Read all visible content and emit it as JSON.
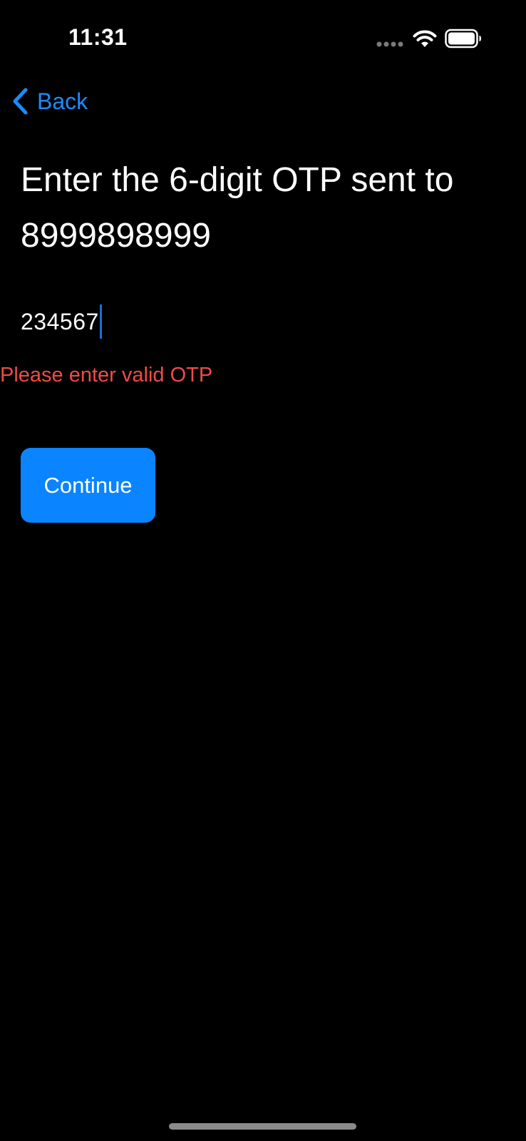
{
  "status_bar": {
    "time": "11:31",
    "icons": [
      "cellular-signal-icon",
      "wifi-icon",
      "battery-icon"
    ]
  },
  "nav": {
    "back_label": "Back",
    "back_icon": "chevron-left-icon"
  },
  "heading": "Enter the 6-digit OTP sent to 8999898999",
  "otp": {
    "value": "234567"
  },
  "error": "Please enter valid OTP",
  "continue_label": "Continue",
  "colors": {
    "background": "#000000",
    "accent": "#0a84ff",
    "link": "#1a8cff",
    "error": "#ef4b47",
    "text": "#ffffff"
  }
}
